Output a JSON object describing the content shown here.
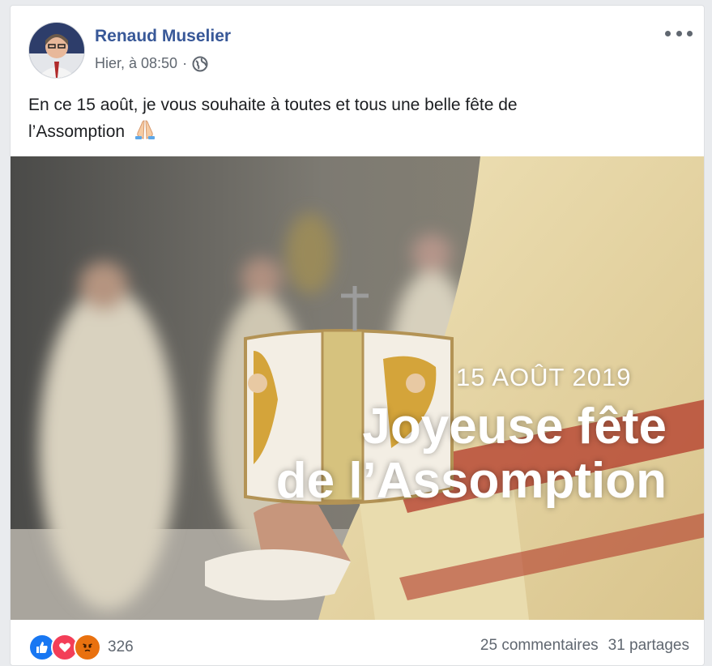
{
  "post": {
    "author": "Renaud Muselier",
    "time": "Hier, à 08:50",
    "separator": "·",
    "privacy_icon": "globe-icon",
    "more_icon": "more-options-icon",
    "text_line1": "En ce 15 août, je vous souhaite à toutes et tous une belle fête de",
    "text_line2": "l’Assomption",
    "text_emoji": "folded-hands-icon"
  },
  "photo": {
    "overlay_date": "15 AOÛT 2019",
    "overlay_title_line1": "Joyeuse fête",
    "overlay_title_line2": "de l’Assomption"
  },
  "footer": {
    "reaction_icons": [
      "like-icon",
      "love-icon",
      "angry-icon"
    ],
    "reaction_count": "326",
    "comments": "25 commentaires",
    "shares": "31 partages"
  },
  "colors": {
    "author_link": "#385898",
    "like": "#1877f2",
    "love": "#f33e58",
    "angry": "#e9710f",
    "meta_gray": "#606770"
  }
}
